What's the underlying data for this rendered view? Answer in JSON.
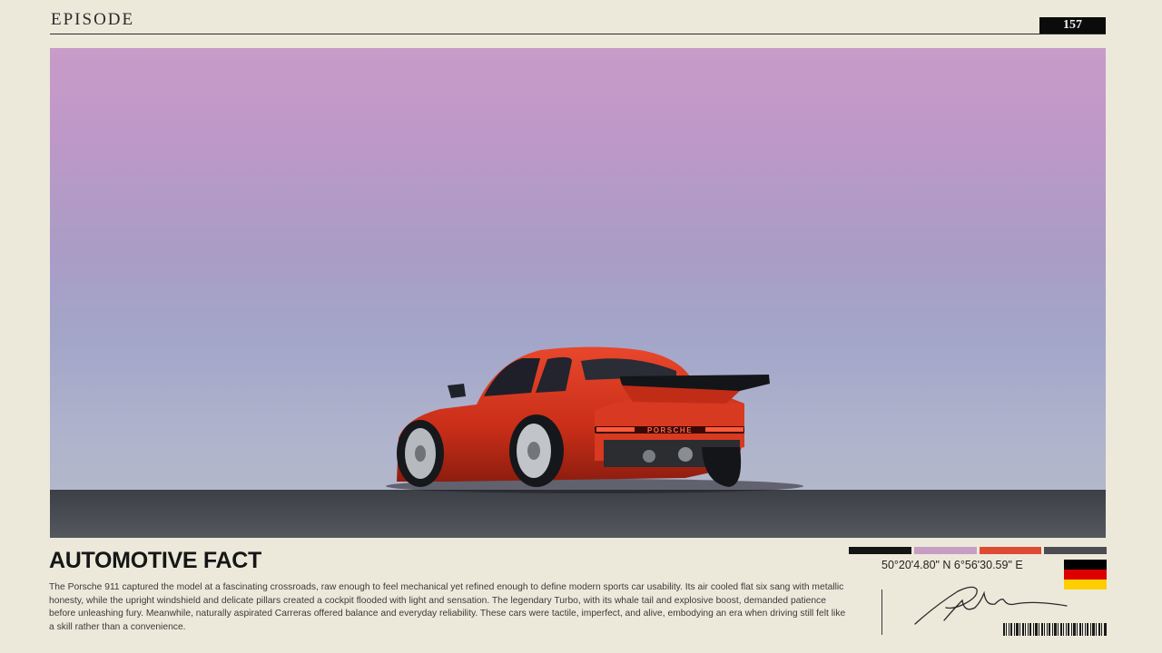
{
  "header": {
    "episode_label": "EPISODE",
    "episode_number": "157"
  },
  "fact": {
    "title": "AUTOMOTIVE FACT",
    "body": "The Porsche 911 captured the model at a fascinating crossroads, raw enough to feel mechanical yet refined enough to define modern sports car usability. Its air cooled flat six sang with metallic honesty, while the upright windshield and delicate pillars created a cockpit flooded with light and sensation. The legendary Turbo, with its whale tail and explosive boost, demanded patience before unleashing fury. Meanwhile, naturally aspirated Carreras offered balance and everyday reliability. These cars were tactile, imperfect, and alive, embodying an era when driving still felt like a skill rather than a convenience."
  },
  "photo": {
    "plate_text": "PORSCHE",
    "car_color": "#d8361f"
  },
  "palette": [
    "#141414",
    "#c69ec4",
    "#df4a33",
    "#4c4d52"
  ],
  "location": {
    "coordinates": "50°20'4.80\" N 6°56'30.59\" E",
    "flag_colors": [
      "#000000",
      "#dd0000",
      "#ffce00"
    ]
  }
}
